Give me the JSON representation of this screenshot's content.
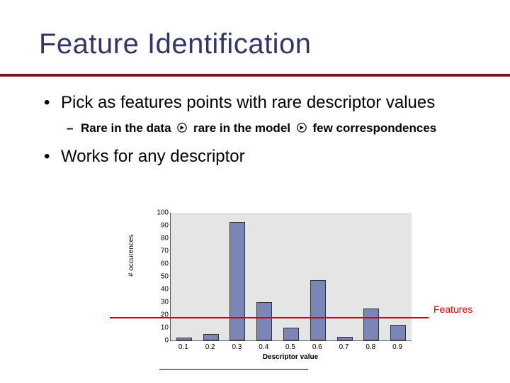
{
  "title": "Feature Identification",
  "bullet1": "Pick as features points with rare descriptor values",
  "sub_a": "Rare in the data",
  "sub_b": "rare in the model",
  "sub_c": "few correspondences",
  "bullet2": "Works for any descriptor",
  "features_label": "Features",
  "chart_data": {
    "type": "bar",
    "categories": [
      "0.1",
      "0.2",
      "0.3",
      "0.4",
      "0.5",
      "0.6",
      "0.7",
      "0.8",
      "0.9"
    ],
    "values": [
      2,
      5,
      93,
      30,
      10,
      47,
      3,
      25,
      12
    ],
    "xlabel": "Descriptor value",
    "ylabel": "# occurences",
    "ylim": [
      0,
      100
    ],
    "yticks": [
      0,
      10,
      20,
      30,
      40,
      50,
      60,
      70,
      80,
      90,
      100
    ],
    "threshold": 18
  }
}
